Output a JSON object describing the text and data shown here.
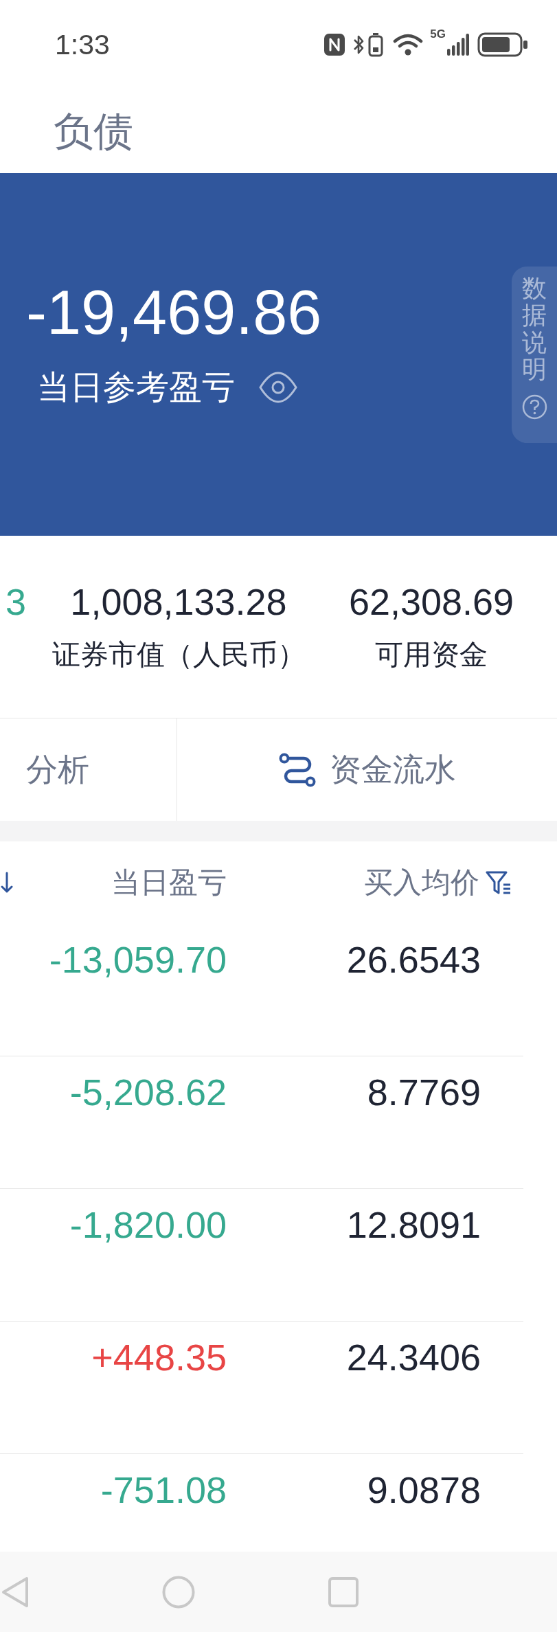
{
  "status_bar": {
    "time": "1:33",
    "network": "5G"
  },
  "header": {
    "tabs": [
      {
        "label": "负债",
        "selected": false
      }
    ]
  },
  "summary": {
    "value": "-19,469.86",
    "label": "当日参考盈亏",
    "note": "数据说明"
  },
  "stats": [
    {
      "value": "3",
      "color": "#36a98f"
    },
    {
      "value": "1,008,133.28",
      "label": "证券市值（人民币）",
      "color": "#1f2433"
    },
    {
      "value": "62,308.69",
      "label": "可用资金",
      "color": "#1f2433"
    }
  ],
  "actions": [
    {
      "label": "分析",
      "kind": "text"
    },
    {
      "label": "资金流水",
      "kind": "icon"
    }
  ],
  "table": {
    "columns": [
      {
        "sorted": true
      },
      {
        "label": "当日盈亏"
      },
      {
        "label": "买入均价",
        "filter": true
      }
    ],
    "rows": [
      {
        "daily_pl": "-13,059.70",
        "color": "#36a98f",
        "avg_price": "26.6543"
      },
      {
        "daily_pl": "-5,208.62",
        "color": "#36a98f",
        "avg_price": "8.7769"
      },
      {
        "daily_pl": "-1,820.00",
        "color": "#36a98f",
        "avg_price": "12.8091"
      },
      {
        "daily_pl": "+448.35",
        "color": "#e84545",
        "avg_price": "24.3406"
      },
      {
        "daily_pl": "-751.08",
        "color": "#36a98f",
        "avg_price": "9.0878"
      }
    ]
  }
}
